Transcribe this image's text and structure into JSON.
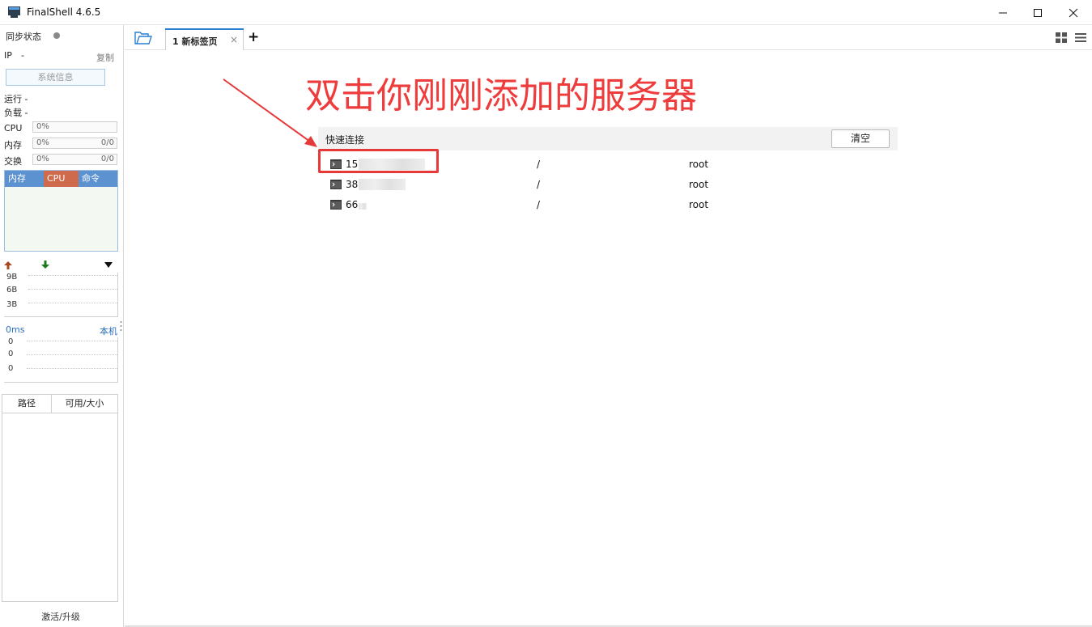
{
  "window": {
    "title": "FinalShell 4.6.5",
    "minimize_icon": "minimize-icon",
    "maximize_icon": "maximize-icon",
    "close_icon": "close-icon"
  },
  "sidebar": {
    "sync_label": "同步状态",
    "ip_label": "IP",
    "ip_value": "-",
    "copy_label": "复制",
    "sysinfo_button": "系统信息",
    "uptime_label": "运行 -",
    "load_label": "负载 -",
    "meters": [
      {
        "label": "CPU",
        "percent": "0%",
        "ratio": ""
      },
      {
        "label": "内存",
        "percent": "0%",
        "ratio": "0/0"
      },
      {
        "label": "交换",
        "percent": "0%",
        "ratio": "0/0"
      }
    ],
    "process_tabs": [
      "内存",
      "CPU",
      "命令"
    ],
    "network": {
      "upload_icon": "arrow-up-icon",
      "download_icon": "arrow-down-icon",
      "dropdown_icon": "dropdown-icon",
      "scale": [
        "9B",
        "6B",
        "3B"
      ]
    },
    "ping": {
      "latency": "0ms",
      "target": "本机",
      "scale": [
        "0",
        "0",
        "0"
      ]
    },
    "disk_columns": [
      "路径",
      "可用/大小"
    ],
    "activate_label": "激活/升级"
  },
  "tabs": {
    "active_tab": "1  新标签页",
    "close_glyph": "×",
    "add_glyph": "+"
  },
  "annotation": {
    "text": "双击你刚刚添加的服务器",
    "color": "#ee3b3b"
  },
  "quick_connect": {
    "title": "快速连接",
    "clear_button": "清空",
    "rows": [
      {
        "host": "15",
        "path": "/",
        "user": "root"
      },
      {
        "host": "38",
        "path": "/",
        "user": "root"
      },
      {
        "host": "66",
        "path": "/",
        "user": "root"
      }
    ]
  },
  "colors": {
    "accent": "#2a7fd4",
    "process_header": "#5d92d1",
    "cpu_tab": "#cf6a4c",
    "highlight": "#e5393a"
  }
}
